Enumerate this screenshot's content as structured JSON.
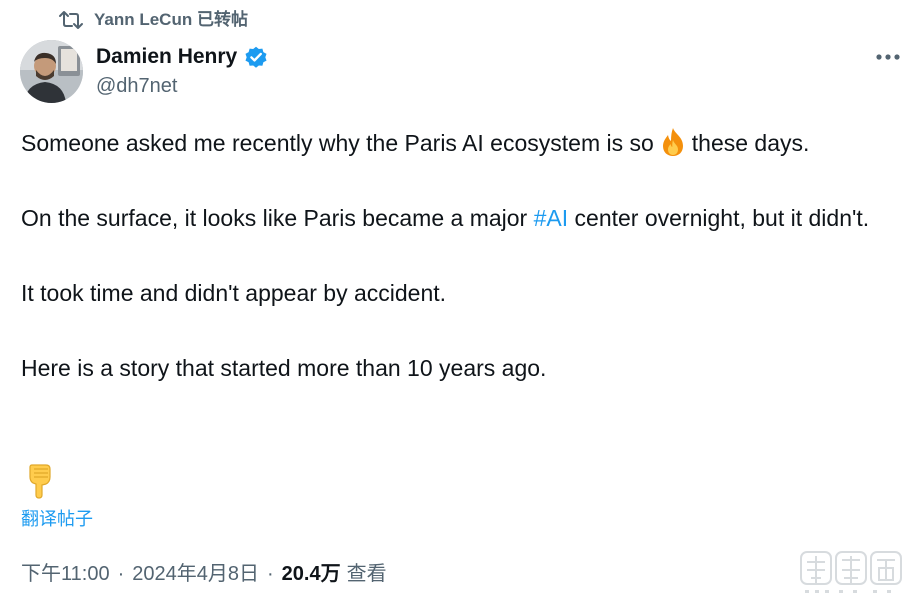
{
  "repost": {
    "text": "Yann LeCun 已转帖",
    "icon": "repost-icon"
  },
  "author": {
    "display_name": "Damien Henry",
    "handle": "@dh7net",
    "verified": true,
    "verified_color": "#1d9bf0",
    "avatar_icon": "avatar"
  },
  "menu": {
    "icon": "more-icon"
  },
  "tweet": {
    "p1_before": "Someone asked me recently why the Paris AI ecosystem is so",
    "p1_emoji": "fire-emoji",
    "p1_after": "these days.",
    "p2_before": "On the surface, it looks like Paris became a major",
    "p2_hashtag": "#AI",
    "p2_after": "center overnight, but it didn't.",
    "p3": "It took time and didn't appear by accident.",
    "p4": "Here is a story that started more than 10 years ago.",
    "trailing_emoji": "pointing-down-emoji"
  },
  "translate": {
    "label": "翻译帖子"
  },
  "meta": {
    "time": "下午11:00",
    "separator": "·",
    "date": "2024年4月8日",
    "views_count": "20.4万",
    "views_label": "查看"
  },
  "colors": {
    "link": "#1d9bf0",
    "secondary_text": "#536471",
    "primary_text": "#0f1419"
  }
}
